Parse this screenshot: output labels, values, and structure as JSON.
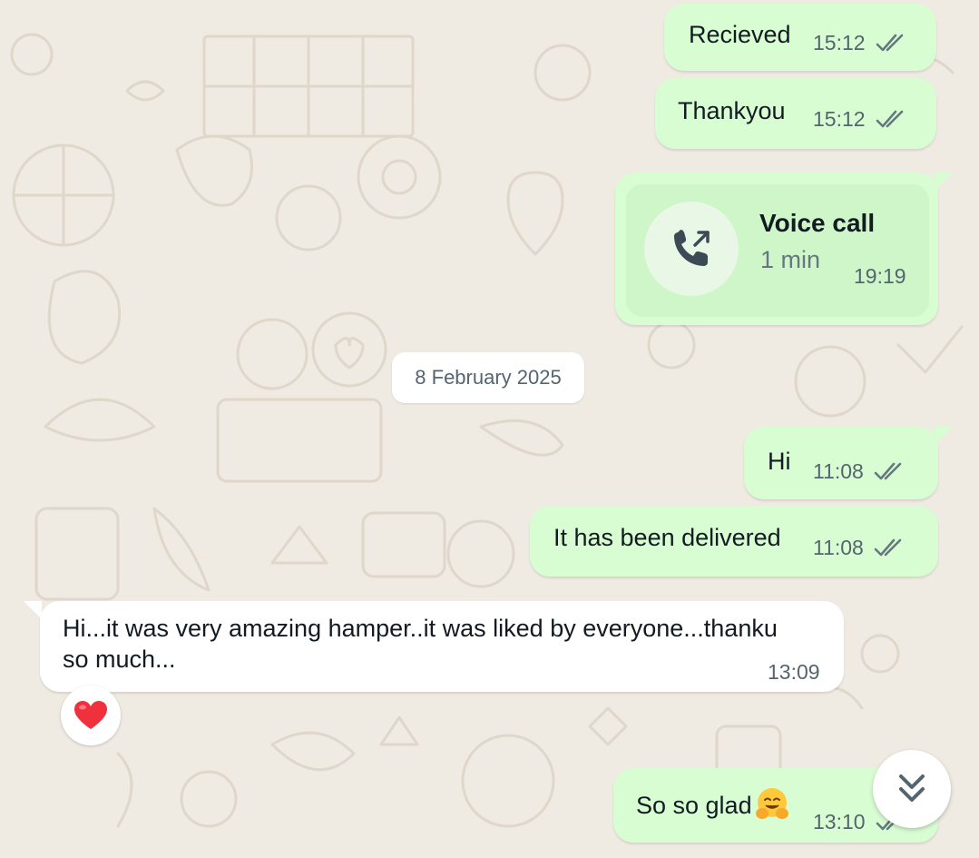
{
  "messages": [
    {
      "text": "Recieved",
      "time": "15:12",
      "status": "read"
    },
    {
      "text": "Thankyou",
      "time": "15:12",
      "status": "read"
    },
    {
      "call_title": "Voice call",
      "call_duration": "1 min",
      "time": "19:19"
    },
    {
      "text": "Hi",
      "time": "11:08",
      "status": "read"
    },
    {
      "text": "It has been delivered",
      "time": "11:08",
      "status": "read"
    },
    {
      "text_line1": "Hi...it was very amazing hamper..it was liked by everyone...thanku",
      "text_line2": "so much...",
      "time": "13:09",
      "reaction": "heart"
    },
    {
      "text": "So so glad",
      "emoji": "hugging-face",
      "time": "13:10",
      "status": "read"
    }
  ],
  "date_separator": "8 February 2025",
  "colors": {
    "background": "#efeae2",
    "outgoing_bubble": "#d9fdd3",
    "incoming_bubble": "#ffffff",
    "meta_text": "#54656f",
    "reaction_heart": "#f0303c"
  },
  "icons": {
    "read_receipt": "double-check-icon",
    "call": "outgoing-call-icon",
    "scroll": "double-chevron-down-icon",
    "reaction": "heart-icon"
  }
}
